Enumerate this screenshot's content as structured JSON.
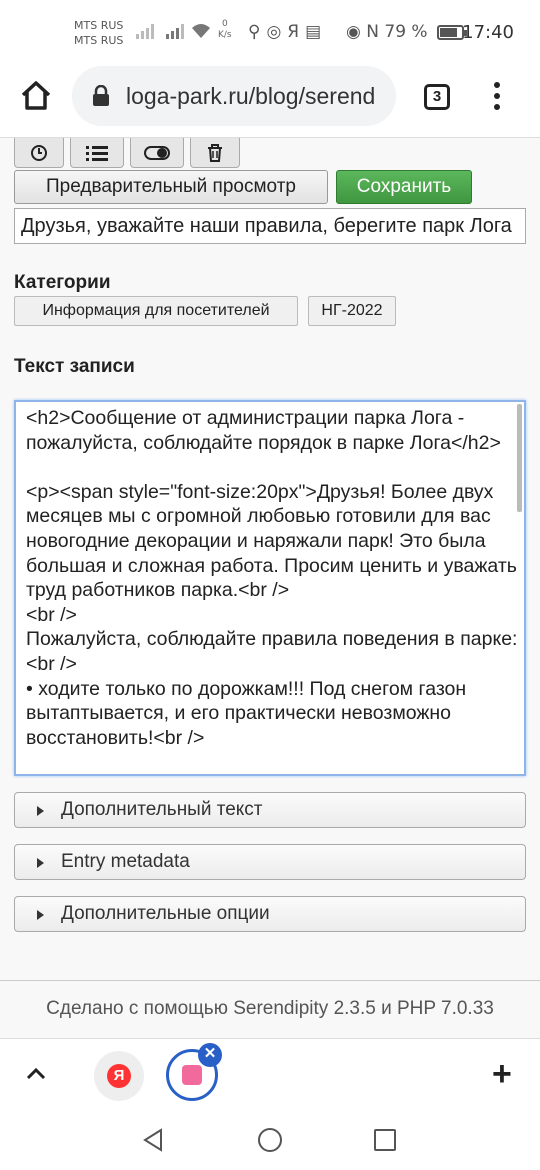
{
  "status_bar": {
    "carrier_1": "MTS RUS",
    "carrier_2": "MTS RUS",
    "net_speed": "0",
    "net_unit": "K/s",
    "yandex_glyph": "Я",
    "battery_label": "79 %",
    "battery_level": 0.79,
    "time": "17:40"
  },
  "browser": {
    "url": "loga-park.ru/blog/serend",
    "tab_count": "3"
  },
  "editor": {
    "preview_button": "Предварительный просмотр",
    "save_button": "Сохранить",
    "title_value": "Друзья, уважайте наши правила, берегите парк Лога",
    "categories_label": "Категории",
    "categories": [
      "Информация для посетителей",
      "НГ-2022"
    ],
    "body_label": "Текст записи",
    "body_text": "<h2>Сообщение от администрации парка Лога - пожалуйста, соблюдайте порядок в парке Лога</h2>\n\n<p><span style=\"font-size:20px\">Друзья! Более двух месяцев мы с огромной любовью готовили для вас новогодние декорации и наряжали парк! Это была большая и сложная работа. Просим ценить и уважать труд работников парка.<br />\n<br />\nПожалуйста, соблюдайте правила поведения в парке:<br />\n• ходите только по дорожкам!!! Под снегом газон вытаптывается, и его практически невозможно восстановить!<br />",
    "sections": [
      "Дополнительный текст",
      "Entry metadata",
      "Дополнительные опции"
    ],
    "footer": "Сделано с помощью Serendipity 2.3.5 и PHP 7.0.33"
  },
  "bottom_bar": {
    "yandex_glyph": "Я",
    "close_glyph": "✕",
    "plus_glyph": "+"
  },
  "colors": {
    "save_green": "#4caf50",
    "focus_blue": "#8fb5e8",
    "tab_ring_blue": "#2860c8"
  }
}
